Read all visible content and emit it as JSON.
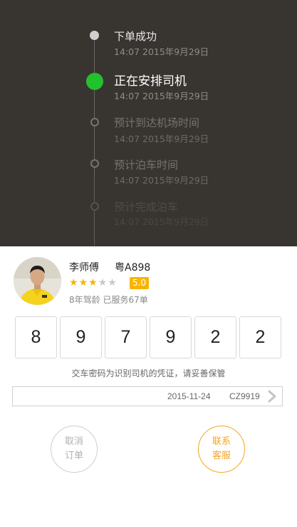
{
  "timeline": [
    {
      "title": "下单成功",
      "time": "14:07 2015年9月29日",
      "state": "done"
    },
    {
      "title": "正在安排司机",
      "time": "14:07 2015年9月29日",
      "state": "active"
    },
    {
      "title": "预计到达机场时间",
      "time": "14:07 2015年9月29日",
      "state": "pending"
    },
    {
      "title": "预计泊车时间",
      "time": "14:07 2015年9月29日",
      "state": "pending"
    },
    {
      "title": "预计完成泊车",
      "time": "14:07 2015年9月29日",
      "state": "faint"
    }
  ],
  "driver": {
    "name": "李师傅",
    "plate": "粤A898",
    "stars": 3,
    "max_stars": 5,
    "rating": "5.0",
    "experience": "8年驾龄 已服务67单"
  },
  "code": {
    "digits": [
      "8",
      "9",
      "7",
      "9",
      "2",
      "2"
    ],
    "hint": "交车密码为识别司机的凭证，请妥善保管"
  },
  "flight": {
    "date": "2015-11-24",
    "number": "CZ9919",
    "icon": "chevron-right-icon"
  },
  "actions": {
    "cancel": {
      "line1": "取消",
      "line2": "订单"
    },
    "contact": {
      "line1": "联系",
      "line2": "客服"
    }
  },
  "colors": {
    "header_bg": "#383531",
    "active_green": "#22c22e",
    "accent_orange": "#f7b500",
    "contact_orange": "#f5a623"
  }
}
